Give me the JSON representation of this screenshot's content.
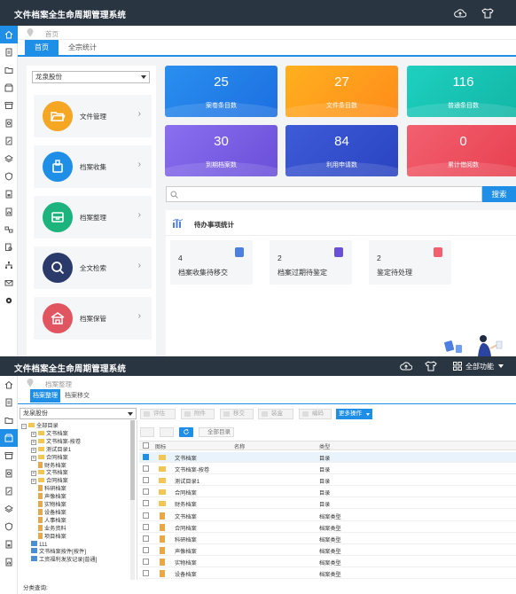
{
  "app_title": "文件档案全生命周期管理系统",
  "top": {
    "breadcrumb": "首页",
    "tabs": [
      "首页",
      "全宗统计"
    ],
    "company_select": "龙泉股份",
    "modules": [
      {
        "label": "文件管理",
        "icon": "folder-open-icon",
        "color": "#f5a623"
      },
      {
        "label": "档案收集",
        "icon": "archive-collect-icon",
        "color": "#1e8ee6"
      },
      {
        "label": "档案整理",
        "icon": "archive-box-icon",
        "color": "#1cb47c"
      },
      {
        "label": "全文检索",
        "icon": "magnifier-icon",
        "color": "#2a3a6b"
      },
      {
        "label": "档案保管",
        "icon": "building-icon",
        "color": "#e05560"
      }
    ],
    "stats": [
      {
        "value": "25",
        "label": "案卷条目数",
        "color_from": "#2a8ff0",
        "color_to": "#1c6fe0"
      },
      {
        "value": "27",
        "label": "文件条目数",
        "color_from": "#ffb01f",
        "color_to": "#ff8c1a"
      },
      {
        "value": "116",
        "label": "普通条目数",
        "color_from": "#1ed0c0",
        "color_to": "#12b6a6"
      },
      {
        "value": "30",
        "label": "到期档案数",
        "color_from": "#8a6ff0",
        "color_to": "#6a4fd8"
      },
      {
        "value": "84",
        "label": "利用申请数",
        "color_from": "#3e5bd8",
        "color_to": "#2a44c0"
      },
      {
        "value": "0",
        "label": "累计借阅数",
        "color_from": "#f26070",
        "color_to": "#e8404f"
      }
    ],
    "search": {
      "placeholder": "",
      "button": "搜索"
    },
    "todo": {
      "title": "待办事项统计",
      "items": [
        {
          "count": "4",
          "label": "档案收集待移交",
          "icon_color": "#4c7fe0"
        },
        {
          "count": "2",
          "label": "档案过期待鉴定",
          "icon_color": "#6a4fd8"
        },
        {
          "count": "2",
          "label": "鉴定待处理",
          "icon_color": "#f26070"
        }
      ]
    }
  },
  "bottom": {
    "breadcrumb": "档案整理",
    "tabs": [
      "档案整理",
      "档案移交"
    ],
    "all_functions": "全部功能",
    "company_select": "龙泉股份",
    "toolbar": [
      "评估",
      "附件",
      "移交",
      "装盒",
      "编码"
    ],
    "more_actions": "更多操作",
    "all_dirs_label": "全部目录",
    "tree": [
      {
        "label": "全部目录",
        "level": 0,
        "type": "root"
      },
      {
        "label": "文书档案",
        "level": 1,
        "type": "folder"
      },
      {
        "label": "文书档案-按卷",
        "level": 1,
        "type": "folder"
      },
      {
        "label": "测试目录1",
        "level": 1,
        "type": "folder"
      },
      {
        "label": "合同档案",
        "level": 1,
        "type": "folder"
      },
      {
        "label": "财务档案",
        "level": 1,
        "type": "leaf"
      },
      {
        "label": "文书档案",
        "level": 1,
        "type": "folder"
      },
      {
        "label": "合同档案",
        "level": 1,
        "type": "folder"
      },
      {
        "label": "科研档案",
        "level": 1,
        "type": "leaf"
      },
      {
        "label": "声像档案",
        "level": 1,
        "type": "leaf"
      },
      {
        "label": "实物档案",
        "level": 1,
        "type": "leaf"
      },
      {
        "label": "设备档案",
        "level": 1,
        "type": "leaf"
      },
      {
        "label": "人事档案",
        "level": 1,
        "type": "leaf"
      },
      {
        "label": "业务资料",
        "level": 1,
        "type": "leaf"
      },
      {
        "label": "项目档案",
        "level": 1,
        "type": "leaf"
      },
      {
        "label": "111",
        "level": 1,
        "type": "grid"
      },
      {
        "label": "文书档案按件[按件]",
        "level": 1,
        "type": "grid"
      },
      {
        "label": "工资福利发放记录[普通]",
        "level": 1,
        "type": "grid"
      }
    ],
    "classification_label": "分类查询:",
    "grid_headers": {
      "icon": "图标",
      "name": "名称",
      "type": "类型"
    },
    "rows": [
      {
        "name": "文书档案",
        "type": "目录",
        "icon": "folder",
        "checked": true
      },
      {
        "name": "文书档案-按卷",
        "type": "目录",
        "icon": "folder",
        "checked": false
      },
      {
        "name": "测试目录1",
        "type": "目录",
        "icon": "folder",
        "checked": false
      },
      {
        "name": "合同档案",
        "type": "目录",
        "icon": "folder",
        "checked": false
      },
      {
        "name": "财务档案",
        "type": "目录",
        "icon": "folder",
        "checked": false
      },
      {
        "name": "文书档案",
        "type": "档案类型",
        "icon": "doc",
        "checked": false
      },
      {
        "name": "合同档案",
        "type": "档案类型",
        "icon": "doc",
        "checked": false
      },
      {
        "name": "科研档案",
        "type": "档案类型",
        "icon": "doc",
        "checked": false
      },
      {
        "name": "声像档案",
        "type": "档案类型",
        "icon": "doc",
        "checked": false
      },
      {
        "name": "实物档案",
        "type": "档案类型",
        "icon": "doc",
        "checked": false
      },
      {
        "name": "设备档案",
        "type": "档案类型",
        "icon": "doc",
        "checked": false
      }
    ]
  }
}
